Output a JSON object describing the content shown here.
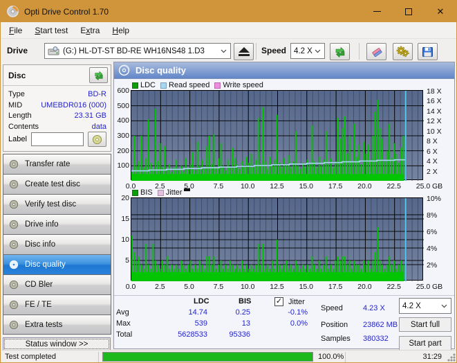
{
  "window": {
    "title": "Opti Drive Control 1.70"
  },
  "menu": {
    "items": [
      {
        "label": "File",
        "underline": 0
      },
      {
        "label": "Start test",
        "underline": 0
      },
      {
        "label": "Extra",
        "underline": 1
      },
      {
        "label": "Help",
        "underline": 0
      }
    ]
  },
  "toolbar": {
    "drive_label": "Drive",
    "drive_value": "(G:)   HL-DT-ST BD-RE  WH16NS48 1.D3",
    "speed_label": "Speed",
    "speed_value": "4.2 X"
  },
  "sidebar": {
    "disc_header": "Disc",
    "info": [
      {
        "label": "Type",
        "value": "BD-R"
      },
      {
        "label": "MID",
        "value": "UMEBDR016 (000)"
      },
      {
        "label": "Length",
        "value": "23.31 GB"
      },
      {
        "label": "Contents",
        "value": "data"
      }
    ],
    "label_row": {
      "label": "Label",
      "value": ""
    },
    "buttons": [
      {
        "label": "Transfer rate",
        "selected": false
      },
      {
        "label": "Create test disc",
        "selected": false
      },
      {
        "label": "Verify test disc",
        "selected": false
      },
      {
        "label": "Drive info",
        "selected": false
      },
      {
        "label": "Disc info",
        "selected": false
      },
      {
        "label": "Disc quality",
        "selected": true
      },
      {
        "label": "CD Bler",
        "selected": false
      },
      {
        "label": "FE / TE",
        "selected": false
      },
      {
        "label": "Extra tests",
        "selected": false
      }
    ],
    "status_window_button": "Status window >>"
  },
  "panel": {
    "title": "Disc quality"
  },
  "chart_data": [
    {
      "type": "bar",
      "name": "ldc-read-speed-chart",
      "legend": [
        {
          "label": "LDC",
          "color": "#0E9B0E"
        },
        {
          "label": "Read speed",
          "color": "#A6D7F2"
        },
        {
          "label": "Write speed",
          "color": "#F08CE0"
        }
      ],
      "x_step_gb": 0.2,
      "xlim": [
        0,
        25
      ],
      "x_ticks": [
        "0.0",
        "2.5",
        "5.0",
        "7.5",
        "10.0",
        "12.5",
        "15.0",
        "17.5",
        "20.0",
        "22.5",
        "25.0"
      ],
      "x_unit": "GB",
      "ylim_left": [
        0,
        600
      ],
      "y_ticks_left": [
        600,
        500,
        400,
        300,
        200,
        100
      ],
      "ylim_right": [
        0,
        18
      ],
      "y_ticks_right": [
        "18 X",
        "16 X",
        "14 X",
        "12 X",
        "10 X",
        "8 X",
        "6 X",
        "4 X",
        "2 X"
      ],
      "hlines": [
        100,
        200,
        300,
        400,
        500
      ],
      "baseline": 45,
      "bar_color": "#02C502",
      "values": [
        60,
        300,
        100,
        130,
        300,
        90,
        150,
        410,
        120,
        80,
        480,
        130,
        250,
        90,
        230,
        70,
        110,
        60,
        90,
        140,
        70,
        100,
        60,
        150,
        80,
        110,
        190,
        70,
        260,
        100,
        140,
        80,
        230,
        300,
        110,
        310,
        90,
        150,
        250,
        100,
        70,
        140,
        90,
        220,
        150,
        110,
        80,
        130,
        90,
        160,
        120,
        180,
        90,
        140,
        420,
        110,
        490,
        130,
        80,
        160,
        100,
        140,
        440,
        120,
        90,
        150,
        110,
        170,
        90,
        130,
        330,
        100,
        80,
        120,
        90,
        140,
        110,
        370,
        130,
        90,
        160,
        100,
        140,
        330,
        110,
        150,
        90,
        130,
        420,
        280,
        350,
        430,
        180,
        300,
        130,
        380,
        160,
        240,
        110,
        260,
        180,
        240,
        140,
        300,
        460,
        539,
        350,
        280,
        130,
        200,
        380,
        150,
        250,
        180,
        120,
        220,
        300,
        470
      ],
      "line_series": {
        "name": "Read speed",
        "color": "#A6D7F2",
        "scale": "right",
        "x": [
          0,
          1.5,
          3,
          4.5,
          6,
          7.5,
          9,
          10.5,
          12,
          13.5,
          15,
          16.5,
          18,
          19.5,
          21,
          22.5,
          23.45
        ],
        "v": [
          2.0,
          2.15,
          2.3,
          2.45,
          2.6,
          2.75,
          2.9,
          3.05,
          3.2,
          3.35,
          3.5,
          3.65,
          3.8,
          3.95,
          4.1,
          4.2,
          4.23
        ]
      },
      "end_position_gb": 23.45,
      "end_line_color": "#4FC8F2"
    },
    {
      "type": "bar",
      "name": "bis-jitter-chart",
      "legend": [
        {
          "label": "BIS",
          "color": "#0E9B0E"
        },
        {
          "label": "Jitter",
          "color": "#E3C0E0",
          "dash": true
        }
      ],
      "x_step_gb": 0.2,
      "xlim": [
        0,
        25
      ],
      "x_ticks": [
        "0.0",
        "2.5",
        "5.0",
        "7.5",
        "10.0",
        "12.5",
        "15.0",
        "17.5",
        "20.0",
        "22.5",
        "25.0"
      ],
      "x_unit": "GB",
      "ylim_left": [
        0,
        20
      ],
      "y_ticks_left": [
        20,
        15,
        10,
        5
      ],
      "ylim_right": [
        0,
        10
      ],
      "y_ticks_right": [
        "10%",
        "8%",
        "6%",
        "4%",
        "2%"
      ],
      "hlines": [
        4,
        5,
        8,
        10,
        12,
        15,
        16
      ],
      "baseline": 2.2,
      "bar_color": "#02C502",
      "values": [
        11,
        7,
        5,
        6,
        4,
        3,
        9,
        4,
        3,
        9,
        5,
        4,
        3,
        5,
        4,
        6,
        3,
        4,
        3,
        4,
        3,
        5,
        4,
        3,
        4,
        5,
        3,
        4,
        3,
        5,
        4,
        3,
        6,
        6,
        4,
        6,
        3,
        4,
        5,
        3,
        4,
        3,
        5,
        4,
        3,
        4,
        3,
        5,
        3,
        4,
        3,
        4,
        3,
        4,
        9,
        4,
        9,
        3,
        4,
        3,
        5,
        3,
        10,
        4,
        3,
        4,
        5,
        3,
        4,
        3,
        5,
        4,
        3,
        4,
        3,
        4,
        3,
        6,
        4,
        3,
        5,
        3,
        4,
        6,
        3,
        4,
        3,
        5,
        6,
        5,
        6,
        6,
        4,
        5,
        3,
        5,
        4,
        4,
        3,
        5,
        4,
        5,
        3,
        5,
        7,
        13,
        5,
        4,
        3,
        4,
        6,
        4,
        5,
        3,
        4,
        5,
        4,
        6
      ],
      "end_position_gb": 23.45,
      "end_line_color": "#4FC8F2"
    }
  ],
  "stats": {
    "col_headers": [
      "LDC",
      "BIS"
    ],
    "jitter_label": "Jitter",
    "jitter_checked": true,
    "rows": [
      {
        "label": "Avg",
        "ldc": "14.74",
        "bis": "0.25",
        "jitter": "-0.1%"
      },
      {
        "label": "Max",
        "ldc": "539",
        "bis": "13",
        "jitter": "0.0%"
      },
      {
        "label": "Total",
        "ldc": "5628533",
        "bis": "95336",
        "jitter": ""
      }
    ],
    "speed_label": "Speed",
    "speed_value": "4.23 X",
    "position_label": "Position",
    "position_value": "23862 MB",
    "samples_label": "Samples",
    "samples_value": "380332",
    "speed_select": "4.2 X",
    "start_full": "Start full",
    "start_part": "Start part"
  },
  "statusbar": {
    "status": "Test completed",
    "progress_value": 100,
    "progress_pct": "100.0%",
    "time": "31:29"
  },
  "colors": {
    "titlebar": "#D0943A",
    "selected_nav": "#1E78D2",
    "chart_bg_top": "#55678B",
    "chart_bg_bottom": "#74839F",
    "bar_green": "#02C502",
    "value_blue": "#2323CC",
    "progress_green": "#1CB81C"
  }
}
